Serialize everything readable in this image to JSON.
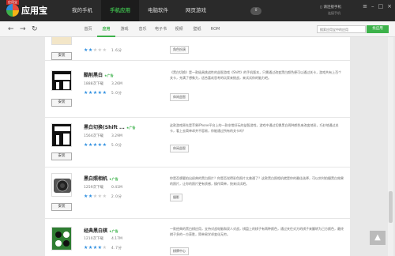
{
  "app": {
    "logo_text": "应用宝",
    "logo_top": "应用宝"
  },
  "nav": {
    "tabs": [
      "我的手机",
      "手机应用",
      "电脑软件",
      "网页游戏"
    ],
    "active": 1,
    "badge": "0"
  },
  "device": {
    "label": "请连接手机",
    "sub": "连接手机"
  },
  "toolbar": {
    "back": "←",
    "forward": "→",
    "refresh": "↻",
    "subtabs": [
      "首页",
      "应用",
      "游戏",
      "音乐",
      "电子书",
      "视频",
      "壁纸",
      "ROM"
    ],
    "active_subtab": 1,
    "search_placeholder": "搜索应用宝中的应用",
    "search_button": "找应用"
  },
  "apps": [
    {
      "name": "",
      "ad": "",
      "downloads": "",
      "size": "",
      "stars": 2,
      "rating": "1.6分",
      "desc": "",
      "tag": "角色扮演",
      "install": "安装"
    },
    {
      "name": "酷削黑白",
      "ad": "★广告",
      "downloads": "1888次下载",
      "size": "3.26M",
      "stars": 5,
      "rating": "5.0分",
      "desc": "《黑白切换》是一款极具挑战性的益智游戏《Shift》的手机版本，只需通过改变黑白颜色便可以通过关卡，游戏共有上百个关卡，充满了想象力，适合喜欢思考的玩家来挑战，来试试你的脑力吧。",
      "tag": "休闲益智",
      "install": "安装"
    },
    {
      "name": "黑白切换(Shift ...",
      "ad": "★广告",
      "downloads": "1564次下载",
      "size": "3.29M",
      "stars": 5,
      "rating": "5.0分",
      "desc": "这款游戏原先是苹果iPhone平台上的一款非常好玩的益智游戏，游戏中通过切换黑白两种颜色来改变地形，巧妙地通过关卡，看上去简单却并不容易，你能通过所有的关卡吗？",
      "tag": "休闲益智",
      "install": "安装"
    },
    {
      "name": "黑白照相机",
      "ad": "★广告",
      "downloads": "1259次下载",
      "size": "0.41M",
      "stars": 2,
      "rating": "2.0分",
      "desc": "你是否想要拍出经典的黑白照片？你是否觉得彩色照片太普通了？这款黑白照相机就是你的最佳选择，可以实时拍摄黑白效果的照片，让你的照片更有质感，操作简单，快来试试吧。",
      "tag": "摄影",
      "install": "安装"
    },
    {
      "name": "经典黑白棋",
      "ad": "★广告",
      "downloads": "1210次下载",
      "size": "4.17M",
      "stars": 4,
      "rating": "4.7分",
      "desc": "一款经典的黑白棋应用，支持对战电脑和双人对战，棋盘上的棋子有两种颜色，通过夹住对方的棋子来翻转为己方颜色，最终棋子多的一方获胜，简单易学却变化无穷。",
      "tag": "棋牌中心",
      "install": "安装"
    }
  ],
  "scroll_top_icon": "▲",
  "colors": {
    "accent": "#3cb24a",
    "star": "#2f8fe0",
    "titlebar": "#2a2a2a"
  }
}
